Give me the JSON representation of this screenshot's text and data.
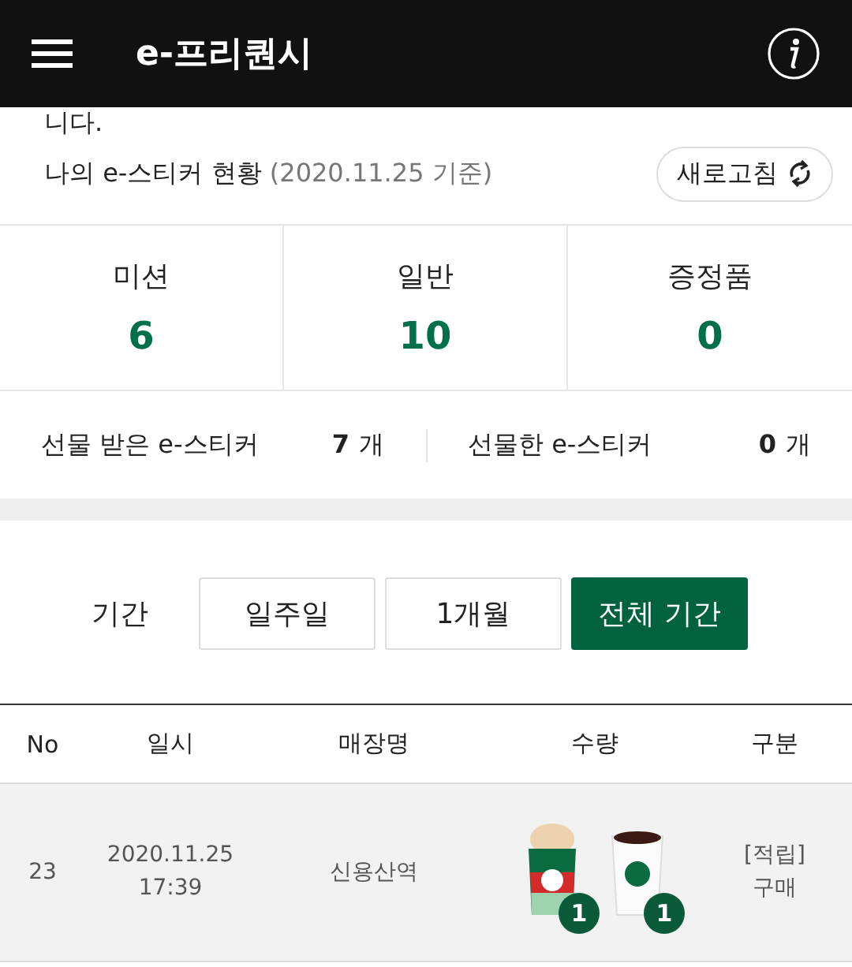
{
  "header": {
    "title": "e-프리퀀시"
  },
  "cut_text": "니다.",
  "summary": {
    "title": "나의 e-스티커 현황",
    "date": "(2020.11.25 기준)",
    "refresh": "새로고침"
  },
  "stats": [
    {
      "label": "미션",
      "value": "6"
    },
    {
      "label": "일반",
      "value": "10"
    },
    {
      "label": "증정품",
      "value": "0"
    }
  ],
  "gifts": [
    {
      "label": "선물 받은 e-스티커",
      "count": "7",
      "unit": "개"
    },
    {
      "label": "선물한 e-스티커",
      "count": "0",
      "unit": "개"
    }
  ],
  "period": {
    "label": "기간",
    "options": [
      {
        "label": "일주일",
        "selected": false
      },
      {
        "label": "1개월",
        "selected": false
      },
      {
        "label": "전체 기간",
        "selected": true
      }
    ]
  },
  "table": {
    "columns": [
      "No",
      "일시",
      "매장명",
      "수량",
      "구분"
    ],
    "rows": [
      {
        "no": "23",
        "date": "2020.11.25",
        "time": "17:39",
        "store": "신용산역",
        "items": [
          {
            "kind": "frappuccino",
            "qty": "1"
          },
          {
            "kind": "hot",
            "qty": "1"
          }
        ],
        "type_tag": "[적립]",
        "type": "구매"
      }
    ]
  }
}
